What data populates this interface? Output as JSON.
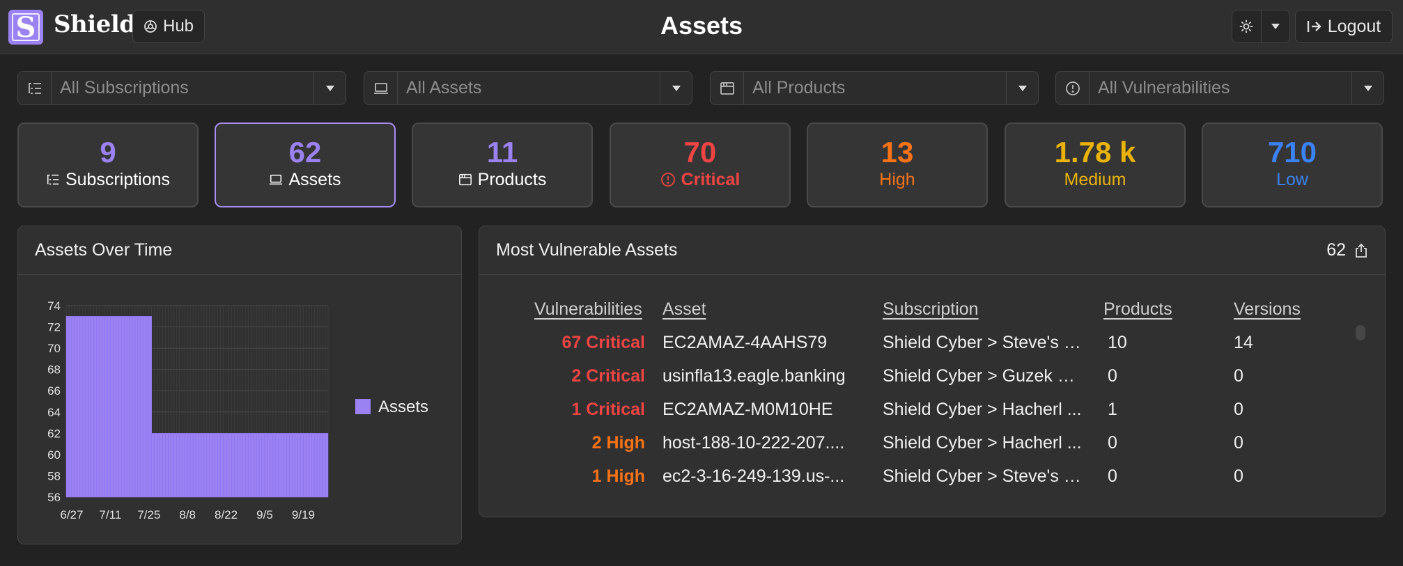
{
  "header": {
    "brand_letter": "S",
    "brand": "Shield",
    "hub_label": "Hub",
    "title": "Assets",
    "logout_label": "Logout",
    "icons": [
      "shield-logo",
      "hub-icon",
      "sun-icon",
      "chevron-down-icon",
      "logout-icon"
    ]
  },
  "filters": [
    {
      "placeholder": "All Subscriptions",
      "icon": "list-icon"
    },
    {
      "placeholder": "All Assets",
      "icon": "laptop-icon"
    },
    {
      "placeholder": "All Products",
      "icon": "browser-window-icon"
    },
    {
      "placeholder": "All Vulnerabilities",
      "icon": "alert-circle-icon"
    }
  ],
  "stats": [
    {
      "value": "9",
      "label": "Subscriptions",
      "color": "#9b82f2",
      "label_color": "#ffffff",
      "icon": "list-icon"
    },
    {
      "value": "62",
      "label": "Assets",
      "color": "#9b82f2",
      "label_color": "#ffffff",
      "icon": "laptop-icon",
      "active": true
    },
    {
      "value": "11",
      "label": "Products",
      "color": "#9b82f2",
      "label_color": "#ffffff",
      "icon": "browser-window-icon"
    },
    {
      "value": "70",
      "label": "Critical",
      "color": "#ef4444",
      "label_color": "#ef4444",
      "icon": "alert-circle-icon"
    },
    {
      "value": "13",
      "label": "High",
      "color": "#f97316",
      "label_color": "#f97316"
    },
    {
      "value": "1.78 k",
      "label": "Medium",
      "color": "#eab308",
      "label_color": "#eab308"
    },
    {
      "value": "710",
      "label": "Low",
      "color": "#3b82f6",
      "label_color": "#3b82f6"
    }
  ],
  "assets_over_time": {
    "title": "Assets Over Time"
  },
  "chart_data": {
    "type": "bar",
    "title": "Assets Over Time",
    "xlabel": "",
    "ylabel": "",
    "ylim": [
      56,
      74
    ],
    "yticks": [
      56,
      58,
      60,
      62,
      64,
      66,
      68,
      70,
      72,
      74
    ],
    "x_tick_labels": [
      "6/27",
      "7/11",
      "7/25",
      "8/8",
      "8/22",
      "9/5",
      "9/19"
    ],
    "x_range": [
      "6/25",
      "9/28"
    ],
    "color": "#9b82f2",
    "grid": true,
    "legend": "right",
    "series": [
      {
        "name": "Assets",
        "segments": [
          {
            "from": "6/25",
            "to": "7/26",
            "value": 73
          },
          {
            "from": "7/26",
            "to": "9/28",
            "value": 62
          }
        ]
      }
    ]
  },
  "most_vulnerable": {
    "title": "Most Vulnerable Assets",
    "count": "62",
    "columns": [
      "Vulnerabilities",
      "Asset",
      "Subscription",
      "Products",
      "Versions"
    ],
    "rows": [
      {
        "vuln": "67 Critical",
        "severity_color": "#ef4444",
        "asset": "EC2AMAZ-4AAHS79",
        "subscription": "Shield Cyber > Steve's S...",
        "products": "10",
        "versions": "14"
      },
      {
        "vuln": "2 Critical",
        "severity_color": "#ef4444",
        "asset": "usinfla13.eagle.banking",
        "subscription": "Shield Cyber > Guzek & ...",
        "products": "0",
        "versions": "0"
      },
      {
        "vuln": "1 Critical",
        "severity_color": "#ef4444",
        "asset": "EC2AMAZ-M0M10HE",
        "subscription": "Shield Cyber > Hacherl ...",
        "products": "1",
        "versions": "0"
      },
      {
        "vuln": "2 High",
        "severity_color": "#f97316",
        "asset": "host-188-10-222-207....",
        "subscription": "Shield Cyber > Hacherl ...",
        "products": "0",
        "versions": "0"
      },
      {
        "vuln": "1 High",
        "severity_color": "#f97316",
        "asset": "ec2-3-16-249-139.us-...",
        "subscription": "Shield Cyber > Steve's S...",
        "products": "0",
        "versions": "0"
      }
    ]
  }
}
